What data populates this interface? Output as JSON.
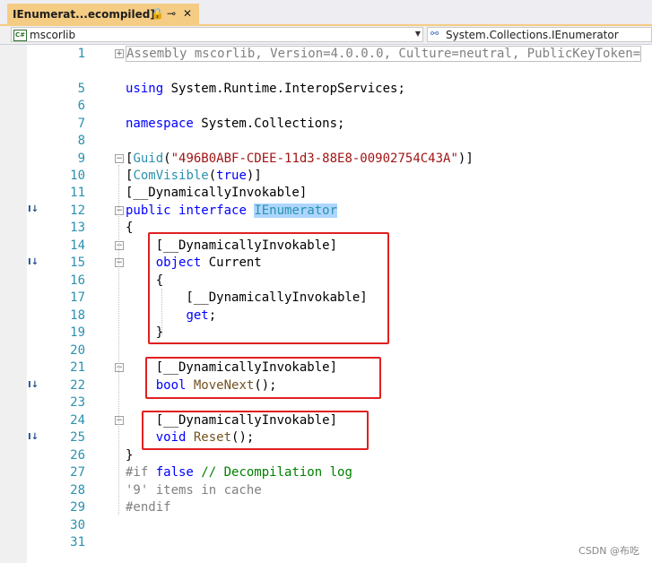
{
  "tab": {
    "title": "IEnumerat...ecompiled]",
    "lock_glyph": "🔒",
    "pin_glyph": "⊸",
    "close_glyph": "✕"
  },
  "navbar": {
    "left_combo": "mscorlib",
    "right_combo": "System.Collections.IEnumerator",
    "cs_badge": "C#",
    "interface_glyph": "⚯",
    "dropdown_glyph": "▼"
  },
  "line_numbers": [
    "1",
    "5",
    "6",
    "7",
    "8",
    "9",
    "10",
    "11",
    "12",
    "13",
    "14",
    "15",
    "16",
    "17",
    "18",
    "19",
    "20",
    "21",
    "22",
    "23",
    "24",
    "25",
    "26",
    "27",
    "28",
    "29",
    "30",
    "31"
  ],
  "code": {
    "l1": "Assembly mscorlib, Version=4.0.0.0, Culture=neutral, PublicKeyToken=",
    "l6a": "using",
    "l6b": " System.Runtime.InteropServices;",
    "l8a": "namespace",
    "l8b": " System.Collections;",
    "l10a": "[",
    "l10b": "Guid",
    "l10c": "(",
    "l10d": "\"496B0ABF-CDEE-11d3-88E8-00902754C43A\"",
    "l10e": ")]",
    "l11a": "[",
    "l11b": "ComVisible",
    "l11c": "(",
    "l11d": "true",
    "l11e": ")]",
    "l12": "[__DynamicallyInvokable]",
    "l13a": "public",
    "l13b": " ",
    "l13c": "interface",
    "l13d": " ",
    "l13e": "IEnumerator",
    "l14": "{",
    "l15": "    [__DynamicallyInvokable]",
    "l16a": "    ",
    "l16b": "object",
    "l16c": " Current",
    "l17": "    {",
    "l18": "        [__DynamicallyInvokable]",
    "l19a": "        ",
    "l19b": "get",
    "l19c": ";",
    "l20": "    }",
    "l22": "    [__DynamicallyInvokable]",
    "l23a": "    ",
    "l23b": "bool",
    "l23c": " ",
    "l23d": "MoveNext",
    "l23e": "();",
    "l25": "    [__DynamicallyInvokable]",
    "l26a": "    ",
    "l26b": "void",
    "l26c": " ",
    "l26d": "Reset",
    "l26e": "();",
    "l27": "}",
    "l28a": "#if ",
    "l28b": "false",
    "l28c": " // Decompilation log",
    "l29": "'9' items in cache",
    "l30": "#endif"
  },
  "collapse_glyphs": {
    "plus": "+",
    "minus": "−"
  },
  "margin_icon_label": "I↓",
  "watermark": "CSDN @布吃",
  "colors": {
    "tab_active": "#f5cc84",
    "keyword": "#0000ff",
    "type": "#2b91af",
    "string": "#a31515",
    "comment": "#008000",
    "highlight": "#add6ff",
    "annotation_box": "#e02020"
  }
}
